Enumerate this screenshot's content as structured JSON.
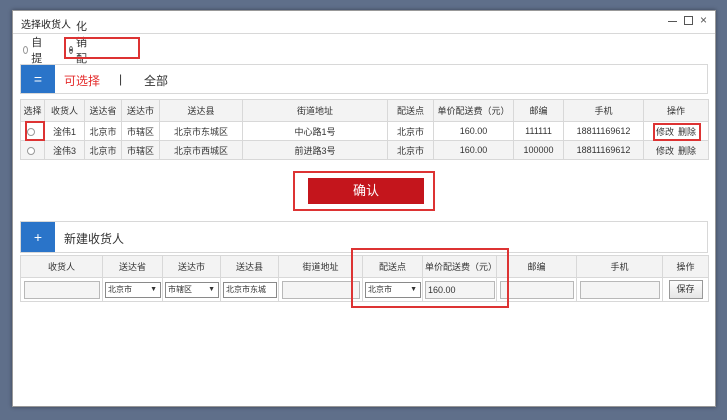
{
  "dialog": {
    "title": "选择收货人"
  },
  "delivery_options": [
    {
      "label": "自 提",
      "checked": false
    },
    {
      "label": "化销配送",
      "checked": true
    }
  ],
  "select_section": {
    "icon_symbol": "=",
    "tab_available": "可选择",
    "separator": "|",
    "tab_all": "全部"
  },
  "table": {
    "headers": [
      "选择",
      "收货人",
      "送达省",
      "送达市",
      "送达县",
      "街道地址",
      "配送点",
      "单价配送费（元）",
      "邮编",
      "手机",
      "操作"
    ],
    "rows": [
      {
        "name": "淦伟1",
        "province": "北京市",
        "city": "市辖区",
        "county": "北京市东城区",
        "street": "中心路1号",
        "point": "北京市",
        "fee": "160.00",
        "zip": "111111",
        "phone": "18811169612",
        "edit": "修改",
        "delete": "删除"
      },
      {
        "name": "淦伟3",
        "province": "北京市",
        "city": "市辖区",
        "county": "北京市西城区",
        "street": "前进路3号",
        "point": "北京市",
        "fee": "160.00",
        "zip": "100000",
        "phone": "18811169612",
        "edit": "修改",
        "delete": "删除"
      }
    ]
  },
  "confirm_label": "确认",
  "new_section": {
    "icon_symbol": "+",
    "title": "新建收货人"
  },
  "new_table": {
    "headers": [
      "收货人",
      "送达省",
      "送达市",
      "送达县",
      "街道地址",
      "配送点",
      "单价配送费（元）",
      "邮编",
      "手机",
      "操作"
    ],
    "province": "北京市",
    "city": "市辖区",
    "county": "北京市东城",
    "point": "北京市",
    "fee": "160.00",
    "save_label": "保存"
  },
  "colors": {
    "primary_blue": "#2a74c9",
    "accent_red": "#e42b2b",
    "confirm_red": "#c4151c",
    "highlight_box": "#dd3333"
  }
}
